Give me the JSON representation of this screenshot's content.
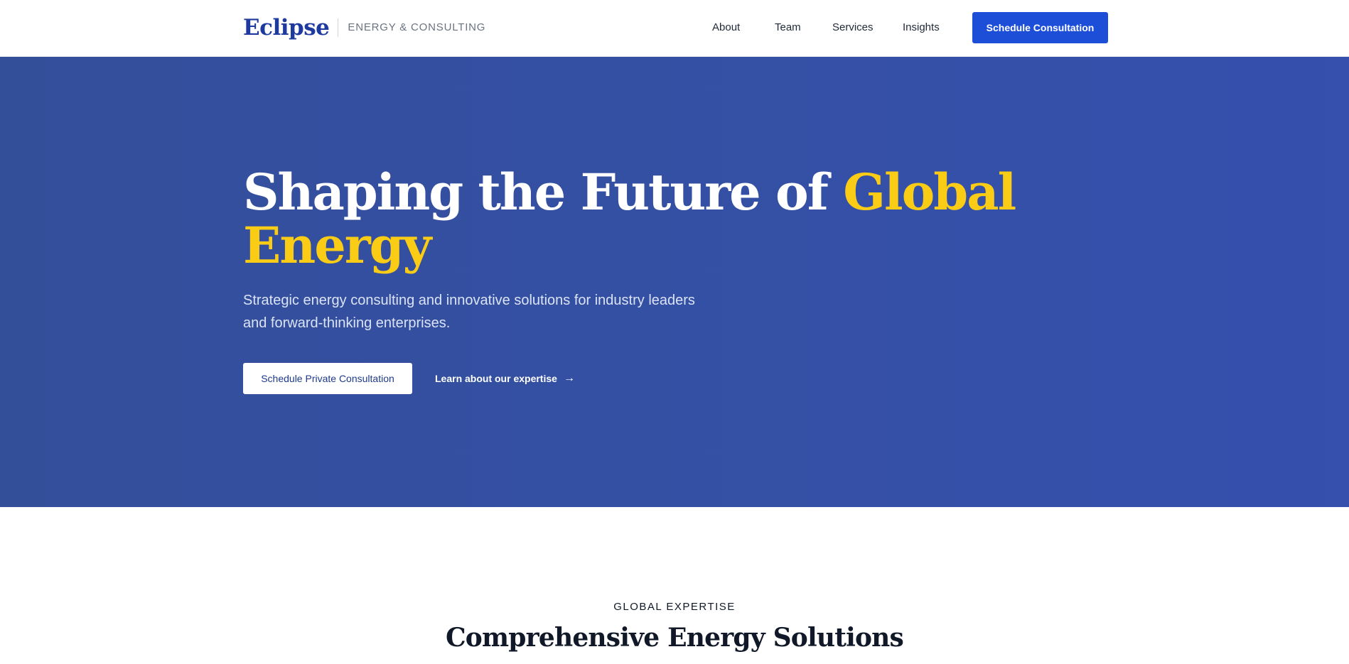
{
  "brand": {
    "name": "Eclipse",
    "tagline": "ENERGY & CONSULTING"
  },
  "nav": {
    "links": [
      "About",
      "Team",
      "Services",
      "Insights"
    ],
    "cta": "Schedule Consultation"
  },
  "hero": {
    "title_main": "Shaping the Future of ",
    "title_accent": "Global Energy",
    "subtitle": "Strategic energy consulting and innovative solutions for industry leaders and forward-thinking enterprises.",
    "primary_button": "Schedule Private Consultation",
    "secondary_link": "Learn about our expertise",
    "secondary_arrow": "→"
  },
  "section": {
    "eyebrow": "GLOBAL EXPERTISE",
    "title": "Comprehensive Energy Solutions"
  },
  "colors": {
    "brand_blue": "#1e3a9f",
    "hero_bg": "#3550ad",
    "accent_yellow": "#facc15",
    "cta_blue": "#1d4ed8"
  }
}
